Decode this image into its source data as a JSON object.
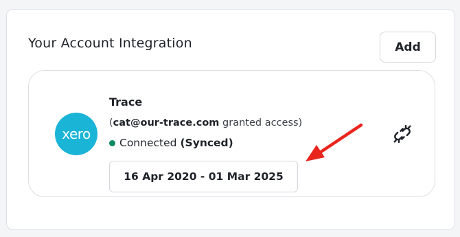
{
  "section": {
    "title": "Your Account Integration",
    "add_label": "Add"
  },
  "integration": {
    "logo_text": "xero",
    "name": "Trace",
    "access_open": "(",
    "email": "cat@our-trace.com",
    "access_suffix": " granted access)",
    "status": "Connected",
    "sync_state": "(Synced)",
    "date_range": "16 Apr 2020 - 01 Mar 2025"
  },
  "icons": {
    "unlink": "unlink-icon",
    "annotation": "red-arrow"
  },
  "colors": {
    "xero_brand": "#1ab4d7",
    "status_green": "#0e8a5f",
    "arrow_red": "#e8261d"
  }
}
